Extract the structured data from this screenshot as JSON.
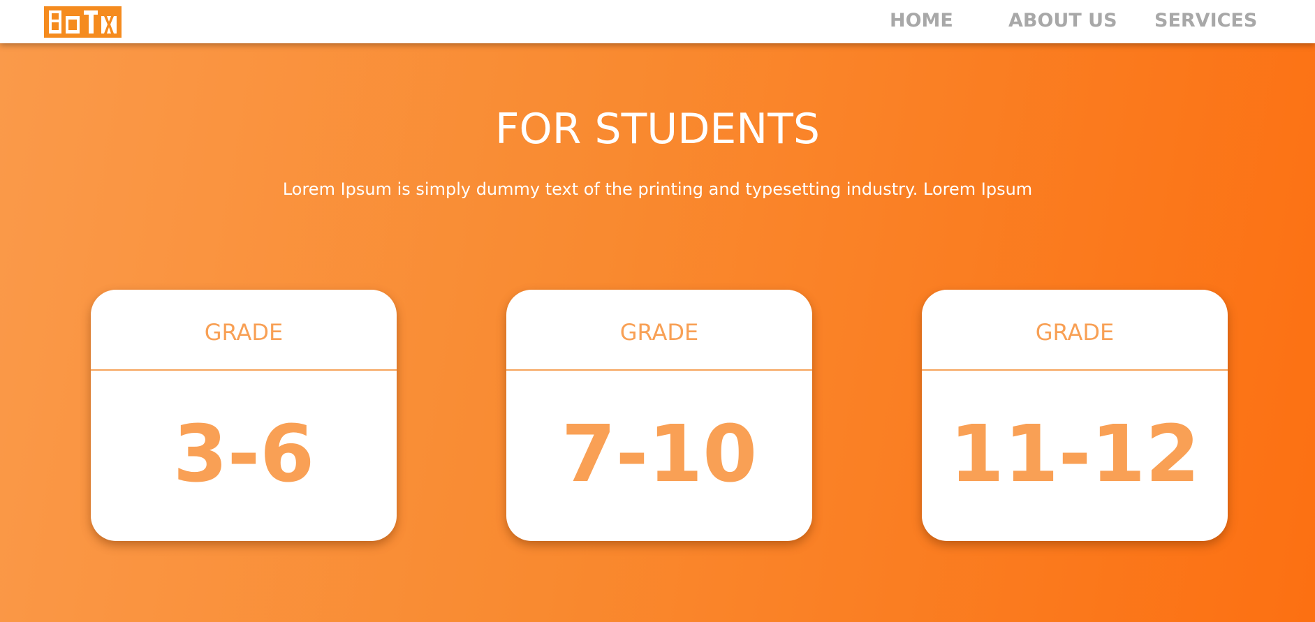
{
  "brand": {
    "logo_text": "BOTX",
    "logo_color": "#f58b1e"
  },
  "nav": {
    "items": [
      {
        "label": "HOME"
      },
      {
        "label": "ABOUT US"
      },
      {
        "label": "SERVICES"
      }
    ]
  },
  "hero": {
    "title": "FOR STUDENTS",
    "subtitle": "Lorem Ipsum is simply dummy text of the printing and typesetting industry. Lorem Ipsum"
  },
  "cards": [
    {
      "label": "GRADE",
      "value": "3-6"
    },
    {
      "label": "GRADE",
      "value": "7-10"
    },
    {
      "label": "GRADE",
      "value": "11-12"
    }
  ],
  "colors": {
    "gradient_start": "#fa9a4a",
    "gradient_end": "#fc7012",
    "card_accent": "#f8a055",
    "nav_text": "#a8a8a8"
  }
}
